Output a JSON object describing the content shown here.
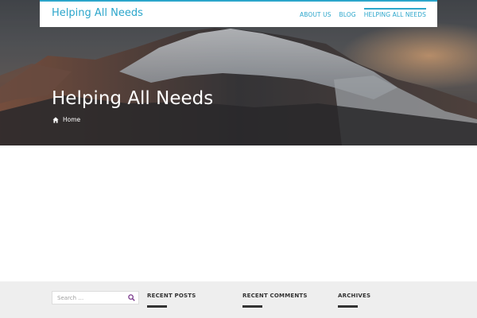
{
  "site": {
    "brand": "Helping All Needs"
  },
  "nav": {
    "items": [
      {
        "label": "ABOUT US"
      },
      {
        "label": "BLOG"
      },
      {
        "label": "HELPING ALL NEEDS",
        "active": true
      }
    ]
  },
  "hero": {
    "title": "Helping All Needs",
    "breadcrumb": {
      "home_label": "Home",
      "icon": "home-icon"
    }
  },
  "footer": {
    "search": {
      "placeholder": "Search …",
      "icon": "search-icon"
    },
    "widgets": [
      {
        "title": "RECENT POSTS"
      },
      {
        "title": "RECENT COMMENTS"
      },
      {
        "title": "ARCHIVES"
      }
    ]
  },
  "colors": {
    "accent": "#2ba6cb",
    "footer_bg": "#eeeeee",
    "search_icon": "#7a3a8c"
  }
}
